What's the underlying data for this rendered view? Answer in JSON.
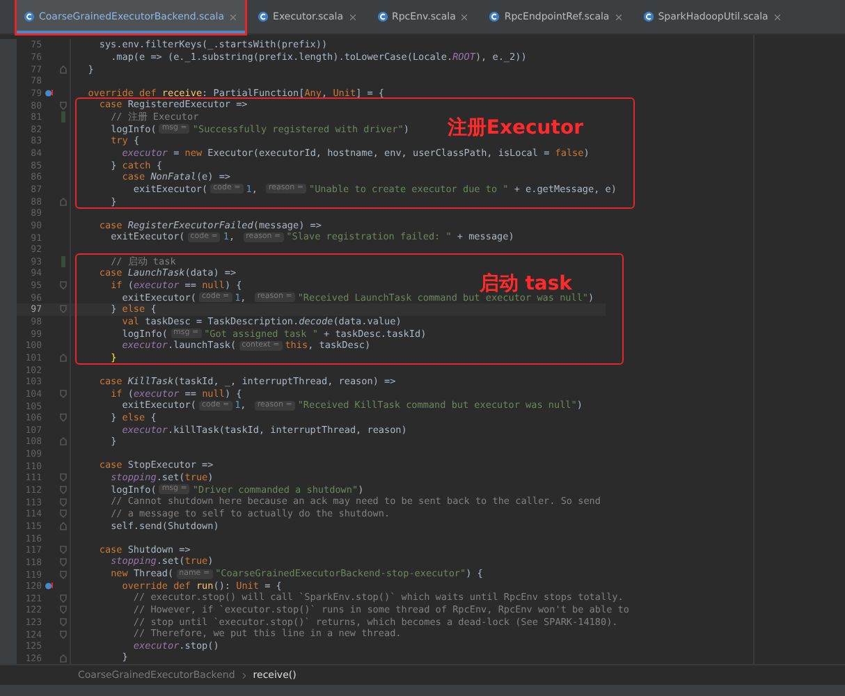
{
  "tabs": [
    {
      "label": "CoarseGrainedExecutorBackend.scala",
      "selected": true,
      "annotated": true
    },
    {
      "label": "Executor.scala",
      "selected": false,
      "annotated": false
    },
    {
      "label": "RpcEnv.scala",
      "selected": false,
      "annotated": false
    },
    {
      "label": "RpcEndpointRef.scala",
      "selected": false,
      "annotated": false
    },
    {
      "label": "SparkHadoopUtil.scala",
      "selected": false,
      "annotated": false
    }
  ],
  "blocks": [
    {
      "lines": [
        {
          "number": "75",
          "current": false,
          "kind": "plain",
          "segments": [
            {
              "kind": "plain",
              "text": "    sys.env.filterKeys(_.startsWith(prefix))"
            }
          ]
        },
        {
          "number": "76",
          "current": false,
          "kind": "plain",
          "segments": [
            {
              "kind": "plain",
              "text": "      .map(e => (e._1.substring(prefix.length).toLowerCase(Locale."
            },
            {
              "kind": "field",
              "text": "ROOT"
            },
            {
              "kind": "plain",
              "text": "), e._2))"
            }
          ]
        },
        {
          "number": "77",
          "current": false,
          "kind": "foldend",
          "segments": [
            {
              "kind": "plain",
              "text": "  }"
            }
          ]
        },
        {
          "number": "78",
          "current": false,
          "kind": "plain"
        },
        {
          "number": "79",
          "current": false,
          "kind": "override",
          "segments": [
            {
              "kind": "kw",
              "text": "  override def "
            },
            {
              "kind": "decl",
              "text": "receive"
            },
            {
              "kind": "plain",
              "text": ": PartialFunction["
            },
            {
              "kind": "kw",
              "text": "Any"
            },
            {
              "kind": "plain",
              "text": ", "
            },
            {
              "kind": "kw",
              "text": "Unit"
            },
            {
              "kind": "plain",
              "text": "] = {"
            }
          ]
        }
      ]
    },
    {
      "annotation": "注册Executor",
      "lines": [
        {
          "number": "80",
          "current": false,
          "kind": "fold",
          "segments": [
            {
              "kind": "kw",
              "text": "    case "
            },
            {
              "kind": "plain",
              "text": "RegisteredExecutor =>"
            }
          ]
        },
        {
          "number": "81",
          "current": false,
          "kind": "change",
          "segments": [
            {
              "kind": "cmt",
              "text": "      // 注册 Executor"
            }
          ]
        },
        {
          "number": "82",
          "current": false,
          "kind": "plain",
          "segments": [
            {
              "kind": "plain",
              "text": "      logInfo("
            },
            {
              "kind": "hint",
              "text": "msg ="
            },
            {
              "kind": "str",
              "text": "\"Successfully registered with driver\""
            },
            {
              "kind": "plain",
              "text": ")"
            }
          ]
        },
        {
          "number": "83",
          "current": false,
          "kind": "plain",
          "segments": [
            {
              "kind": "kw",
              "text": "      try "
            },
            {
              "kind": "plain",
              "text": "{"
            }
          ]
        },
        {
          "number": "84",
          "current": false,
          "kind": "plain",
          "segments": [
            {
              "kind": "field",
              "text": "        executor"
            },
            {
              "kind": "plain",
              "text": " = "
            },
            {
              "kind": "kw",
              "text": "new "
            },
            {
              "kind": "plain",
              "text": "Executor(executorId, hostname, env, userClassPath, isLocal = "
            },
            {
              "kind": "kw",
              "text": "false"
            },
            {
              "kind": "plain",
              "text": ")"
            }
          ]
        },
        {
          "number": "85",
          "current": false,
          "kind": "plain",
          "segments": [
            {
              "kind": "plain",
              "text": "      } "
            },
            {
              "kind": "kw",
              "text": "catch "
            },
            {
              "kind": "plain",
              "text": "{"
            }
          ]
        },
        {
          "number": "86",
          "current": false,
          "kind": "plain",
          "segments": [
            {
              "kind": "kw",
              "text": "        case "
            },
            {
              "kind": "italic",
              "text": "NonFatal"
            },
            {
              "kind": "plain",
              "text": "(e) =>"
            }
          ]
        },
        {
          "number": "87",
          "current": false,
          "kind": "plain",
          "segments": [
            {
              "kind": "plain",
              "text": "          exitExecutor("
            },
            {
              "kind": "hint",
              "text": "code ="
            },
            {
              "kind": "num",
              "text": "1"
            },
            {
              "kind": "plain",
              "text": ", "
            },
            {
              "kind": "hint",
              "text": "reason ="
            },
            {
              "kind": "str",
              "text": "\"Unable to create executor due to \""
            },
            {
              "kind": "plain",
              "text": " + e.getMessage, e)"
            }
          ]
        },
        {
          "number": "88",
          "current": false,
          "kind": "foldend",
          "segments": [
            {
              "kind": "plain",
              "text": "      }"
            }
          ]
        }
      ]
    },
    {
      "lines": [
        {
          "number": "89",
          "current": false,
          "kind": "plain"
        },
        {
          "number": "90",
          "current": false,
          "kind": "plain",
          "segments": [
            {
              "kind": "kw",
              "text": "    case "
            },
            {
              "kind": "italic",
              "text": "RegisterExecutorFailed"
            },
            {
              "kind": "plain",
              "text": "(message) =>"
            }
          ]
        },
        {
          "number": "91",
          "current": false,
          "kind": "plain",
          "segments": [
            {
              "kind": "plain",
              "text": "      exitExecutor("
            },
            {
              "kind": "hint",
              "text": "code ="
            },
            {
              "kind": "num",
              "text": "1"
            },
            {
              "kind": "plain",
              "text": ", "
            },
            {
              "kind": "hint",
              "text": "reason ="
            },
            {
              "kind": "str",
              "text": "\"Slave registration failed: \""
            },
            {
              "kind": "plain",
              "text": " + message)"
            }
          ]
        },
        {
          "number": "92",
          "current": false,
          "kind": "plain"
        }
      ]
    },
    {
      "annotation": "启动 task",
      "lines": [
        {
          "number": "93",
          "current": false,
          "kind": "change",
          "segments": [
            {
              "kind": "cmt",
              "text": "      // 启动 task"
            }
          ]
        },
        {
          "number": "94",
          "current": false,
          "kind": "plain",
          "segments": [
            {
              "kind": "kw",
              "text": "    case "
            },
            {
              "kind": "italic",
              "text": "LaunchTask"
            },
            {
              "kind": "plain",
              "text": "(data) =>"
            }
          ]
        },
        {
          "number": "95",
          "current": false,
          "kind": "fold",
          "segments": [
            {
              "kind": "kw",
              "text": "      if "
            },
            {
              "kind": "plain",
              "text": "("
            },
            {
              "kind": "field",
              "text": "executor"
            },
            {
              "kind": "plain",
              "text": " == "
            },
            {
              "kind": "kw",
              "text": "null"
            },
            {
              "kind": "plain",
              "text": ") {"
            }
          ]
        },
        {
          "number": "96",
          "current": false,
          "kind": "plain",
          "segments": [
            {
              "kind": "plain",
              "text": "        exitExecutor("
            },
            {
              "kind": "hint",
              "text": "code ="
            },
            {
              "kind": "num",
              "text": "1"
            },
            {
              "kind": "plain",
              "text": ", "
            },
            {
              "kind": "hint",
              "text": "reason ="
            },
            {
              "kind": "str",
              "text": "\"Received LaunchTask command but executor was null\""
            },
            {
              "kind": "plain",
              "text": ")"
            }
          ]
        },
        {
          "number": "97",
          "current": true,
          "kind": "fold",
          "segments": [
            {
              "kind": "plain",
              "text": "      } "
            },
            {
              "kind": "kw",
              "text": "else "
            },
            {
              "kind": "plain",
              "text": "{"
            }
          ]
        },
        {
          "number": "98",
          "current": false,
          "kind": "plain",
          "segments": [
            {
              "kind": "kw",
              "text": "        val "
            },
            {
              "kind": "plain",
              "text": "taskDesc = TaskDescription."
            },
            {
              "kind": "italic",
              "text": "decode"
            },
            {
              "kind": "plain",
              "text": "(data.value)"
            }
          ]
        },
        {
          "number": "99",
          "current": false,
          "kind": "plain",
          "segments": [
            {
              "kind": "plain",
              "text": "        logInfo("
            },
            {
              "kind": "hint",
              "text": "msg ="
            },
            {
              "kind": "str",
              "text": "\"Got assigned task \""
            },
            {
              "kind": "plain",
              "text": " + taskDesc.taskId)"
            }
          ]
        },
        {
          "number": "100",
          "current": false,
          "kind": "plain",
          "segments": [
            {
              "kind": "field",
              "text": "        executor"
            },
            {
              "kind": "plain",
              "text": ".launchTask("
            },
            {
              "kind": "hint",
              "text": "context ="
            },
            {
              "kind": "kw",
              "text": "this"
            },
            {
              "kind": "plain",
              "text": ", taskDesc)"
            }
          ]
        },
        {
          "number": "101",
          "current": false,
          "kind": "foldend",
          "segments": [
            {
              "kind": "brace",
              "text": "      }"
            }
          ]
        }
      ]
    },
    {
      "lines": [
        {
          "number": "102",
          "current": false,
          "kind": "plain"
        },
        {
          "number": "103",
          "current": false,
          "kind": "plain",
          "segments": [
            {
              "kind": "kw",
              "text": "    case "
            },
            {
              "kind": "italic",
              "text": "KillTask"
            },
            {
              "kind": "plain",
              "text": "(taskId, _, interruptThread, reason) =>"
            }
          ]
        },
        {
          "number": "104",
          "current": false,
          "kind": "fold",
          "segments": [
            {
              "kind": "kw",
              "text": "      if "
            },
            {
              "kind": "plain",
              "text": "("
            },
            {
              "kind": "field",
              "text": "executor"
            },
            {
              "kind": "plain",
              "text": " == "
            },
            {
              "kind": "kw",
              "text": "null"
            },
            {
              "kind": "plain",
              "text": ") {"
            }
          ]
        },
        {
          "number": "105",
          "current": false,
          "kind": "plain",
          "segments": [
            {
              "kind": "plain",
              "text": "        exitExecutor("
            },
            {
              "kind": "hint",
              "text": "code ="
            },
            {
              "kind": "num",
              "text": "1"
            },
            {
              "kind": "plain",
              "text": ", "
            },
            {
              "kind": "hint",
              "text": "reason ="
            },
            {
              "kind": "str",
              "text": "\"Received KillTask command but executor was null\""
            },
            {
              "kind": "plain",
              "text": ")"
            }
          ]
        },
        {
          "number": "106",
          "current": false,
          "kind": "fold",
          "segments": [
            {
              "kind": "plain",
              "text": "      } "
            },
            {
              "kind": "kw",
              "text": "else "
            },
            {
              "kind": "plain",
              "text": "{"
            }
          ]
        },
        {
          "number": "107",
          "current": false,
          "kind": "plain",
          "segments": [
            {
              "kind": "field",
              "text": "        executor"
            },
            {
              "kind": "plain",
              "text": ".killTask(taskId, interruptThread, reason)"
            }
          ]
        },
        {
          "number": "108",
          "current": false,
          "kind": "foldend",
          "segments": [
            {
              "kind": "plain",
              "text": "      }"
            }
          ]
        },
        {
          "number": "109",
          "current": false,
          "kind": "plain"
        },
        {
          "number": "110",
          "current": false,
          "kind": "plain",
          "segments": [
            {
              "kind": "kw",
              "text": "    case "
            },
            {
              "kind": "plain",
              "text": "StopExecutor =>"
            }
          ]
        },
        {
          "number": "111",
          "current": false,
          "kind": "fold",
          "segments": [
            {
              "kind": "field",
              "text": "      stopping"
            },
            {
              "kind": "plain",
              "text": ".set("
            },
            {
              "kind": "kw",
              "text": "true"
            },
            {
              "kind": "plain",
              "text": ")"
            }
          ]
        },
        {
          "number": "112",
          "current": false,
          "kind": "fold",
          "segments": [
            {
              "kind": "plain",
              "text": "      logInfo("
            },
            {
              "kind": "hint",
              "text": "msg ="
            },
            {
              "kind": "str",
              "text": "\"Driver commanded a shutdown\""
            },
            {
              "kind": "plain",
              "text": ")"
            }
          ]
        },
        {
          "number": "113",
          "current": false,
          "kind": "fold",
          "segments": [
            {
              "kind": "cmt",
              "text": "      // Cannot shutdown here because an ack may need to be sent back to the caller. So send"
            }
          ]
        },
        {
          "number": "114",
          "current": false,
          "kind": "fold",
          "segments": [
            {
              "kind": "cmt",
              "text": "      // a message to self to actually do the shutdown."
            }
          ]
        },
        {
          "number": "115",
          "current": false,
          "kind": "foldend",
          "segments": [
            {
              "kind": "plain",
              "text": "      self.send(Shutdown)"
            }
          ]
        },
        {
          "number": "116",
          "current": false,
          "kind": "plain"
        },
        {
          "number": "117",
          "current": false,
          "kind": "fold",
          "segments": [
            {
              "kind": "kw",
              "text": "    case "
            },
            {
              "kind": "plain",
              "text": "Shutdown =>"
            }
          ]
        },
        {
          "number": "118",
          "current": false,
          "kind": "fold",
          "segments": [
            {
              "kind": "field",
              "text": "      stopping"
            },
            {
              "kind": "plain",
              "text": ".set("
            },
            {
              "kind": "kw",
              "text": "true"
            },
            {
              "kind": "plain",
              "text": ")"
            }
          ]
        },
        {
          "number": "119",
          "current": false,
          "kind": "fold",
          "segments": [
            {
              "kind": "kw",
              "text": "      new "
            },
            {
              "kind": "plain",
              "text": "Thread("
            },
            {
              "kind": "hint",
              "text": "name ="
            },
            {
              "kind": "str",
              "text": "\"CoarseGrainedExecutorBackend-stop-executor\""
            },
            {
              "kind": "plain",
              "text": ") {"
            }
          ]
        },
        {
          "number": "120",
          "current": false,
          "kind": "override",
          "segments": [
            {
              "kind": "kw",
              "text": "        override def "
            },
            {
              "kind": "decl",
              "text": "run"
            },
            {
              "kind": "plain",
              "text": "(): "
            },
            {
              "kind": "kw",
              "text": "Unit"
            },
            {
              "kind": "plain",
              "text": " = {"
            }
          ]
        },
        {
          "number": "121",
          "current": false,
          "kind": "fold",
          "segments": [
            {
              "kind": "cmt",
              "text": "          // executor.stop() will call `SparkEnv.stop()` which waits until RpcEnv stops totally."
            }
          ]
        },
        {
          "number": "122",
          "current": false,
          "kind": "fold",
          "segments": [
            {
              "kind": "cmt",
              "text": "          // However, if `executor.stop()` runs in some thread of RpcEnv, RpcEnv won't be able to"
            }
          ]
        },
        {
          "number": "123",
          "current": false,
          "kind": "fold",
          "segments": [
            {
              "kind": "cmt",
              "text": "          // stop until `executor.stop()` returns, which becomes a dead-lock (See SPARK-14180)."
            }
          ]
        },
        {
          "number": "124",
          "current": false,
          "kind": "fold",
          "segments": [
            {
              "kind": "cmt",
              "text": "          // Therefore, we put this line in a new thread."
            }
          ]
        },
        {
          "number": "125",
          "current": false,
          "kind": "plain",
          "segments": [
            {
              "kind": "field",
              "text": "          executor"
            },
            {
              "kind": "plain",
              "text": ".stop()"
            }
          ]
        },
        {
          "number": "126",
          "current": false,
          "kind": "foldend",
          "segments": [
            {
              "kind": "plain",
              "text": "        }"
            }
          ]
        }
      ]
    }
  ],
  "breadcrumb": [
    "CoarseGrainedExecutorBackend",
    "receive()"
  ]
}
